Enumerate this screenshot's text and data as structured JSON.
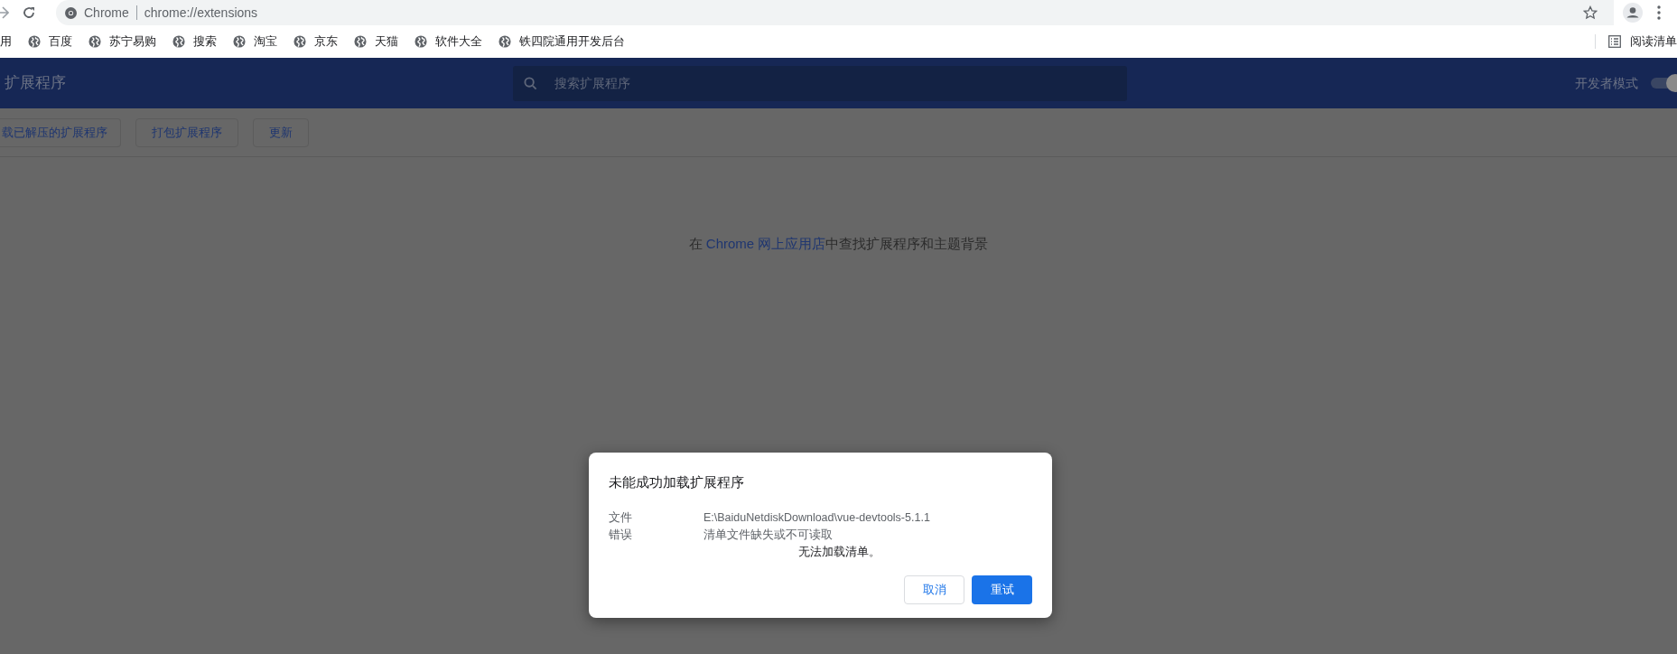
{
  "browser": {
    "site_label": "Chrome",
    "url": "chrome://extensions",
    "bookmarks": [
      "用",
      "百度",
      "苏宁易购",
      "搜索",
      "淘宝",
      "京东",
      "天猫",
      "软件大全",
      "铁四院通用开发后台"
    ],
    "reading_list": "阅读清单"
  },
  "header": {
    "title": "扩展程序",
    "search": {
      "placeholder": "搜索扩展程序"
    },
    "dev_mode": {
      "label": "开发者模式",
      "on": true
    }
  },
  "toolbar": [
    "载已解压的扩展程序",
    "打包扩展程序",
    "更新"
  ],
  "store_hint": {
    "before": "在 ",
    "link": "Chrome 网上应用店",
    "after": "中查找扩展程序和主题背景"
  },
  "dialog": {
    "title": "未能成功加载扩展程序",
    "rows": [
      {
        "label": "文件",
        "value": "E:\\BaiduNetdiskDownload\\vue-devtools-5.1.1"
      },
      {
        "label": "错误",
        "value": "清单文件缺失或不可读取",
        "detail": "无法加载清单。"
      }
    ],
    "buttons": [
      {
        "label": "取消",
        "kind": "secondary"
      },
      {
        "label": "重试",
        "kind": "primary"
      }
    ]
  }
}
